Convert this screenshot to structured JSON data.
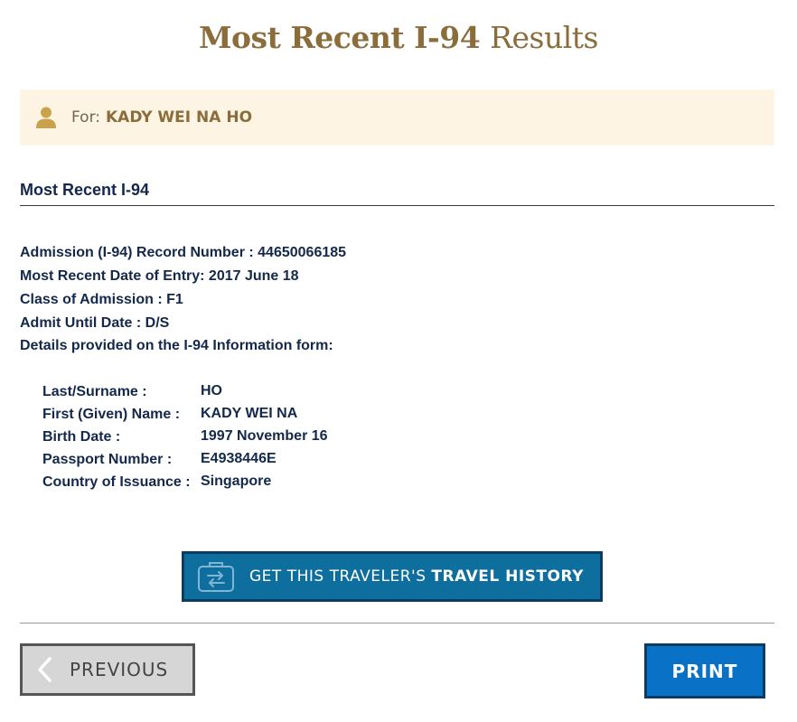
{
  "title": {
    "strong": "Most Recent I-94",
    "light": "Results"
  },
  "for_banner": {
    "icon": "user-icon",
    "label": "For:",
    "name": "KADY WEI NA HO"
  },
  "section": {
    "heading": "Most Recent I-94"
  },
  "details": [
    "Admission (I-94) Record Number : 44650066185",
    "Most Recent Date of Entry: 2017 June 18",
    "Class of Admission : F1",
    "Admit Until Date : D/S",
    "Details provided on the I-94 Information form:"
  ],
  "info_form": [
    {
      "label": "Last/Surname :",
      "value": "HO"
    },
    {
      "label": "First (Given) Name :",
      "value": "KADY WEI NA"
    },
    {
      "label": "Birth Date :",
      "value": "1997 November 16"
    },
    {
      "label": "Passport Number :",
      "value": "E4938446E"
    },
    {
      "label": "Country of Issuance :",
      "value": "Singapore"
    }
  ],
  "travel_history_button": {
    "icon": "luggage-transfer-icon",
    "label_prefix": "GET THIS TRAVELER'S",
    "label_bold": "TRAVEL HISTORY"
  },
  "previous_button": {
    "icon": "chevron-left-icon",
    "label": "PREVIOUS"
  },
  "print_button": {
    "label": "PRINT"
  },
  "colors": {
    "title_gold": "#8b6d3c",
    "banner_bg": "#fdf4e3",
    "text_navy": "#13284a",
    "travel_btn_bg": "#0e6e9e",
    "print_btn_bg": "#0a72c6",
    "prev_btn_bg": "#d6d6d6"
  }
}
